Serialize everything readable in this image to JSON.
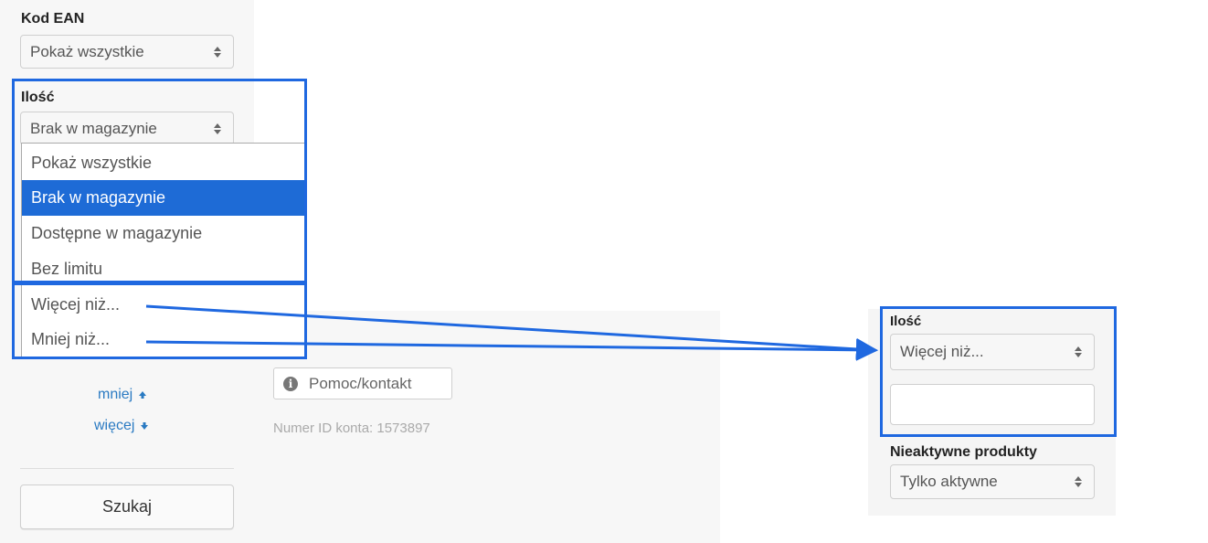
{
  "sidebar": {
    "ean_label": "Kod EAN",
    "ean_select_value": "Pokaż wszystkie",
    "qty_label": "Ilość",
    "qty_select_value": "Brak w magazynie",
    "less_link": "mniej",
    "more_link": "więcej",
    "search_button": "Szukaj"
  },
  "dropdown": {
    "options": [
      "Pokaż wszystkie",
      "Brak w magazynie",
      "Dostępne w magazynie",
      "Bez limitu",
      "Więcej niż...",
      "Mniej niż..."
    ],
    "selected": "Brak w magazynie"
  },
  "main": {
    "help_button": "Pomoc/kontakt",
    "account_id": "Numer ID konta: 1573897"
  },
  "right_panel": {
    "qty_label": "Ilość",
    "qty_select_value": "Więcej niż...",
    "qty_input_value": "",
    "inactive_label": "Nieaktywne produkty",
    "inactive_select_value": "Tylko aktywne"
  },
  "colors": {
    "highlight": "#1f68e0",
    "selected_option": "#1e6bd6",
    "link": "#2a7ac2"
  }
}
